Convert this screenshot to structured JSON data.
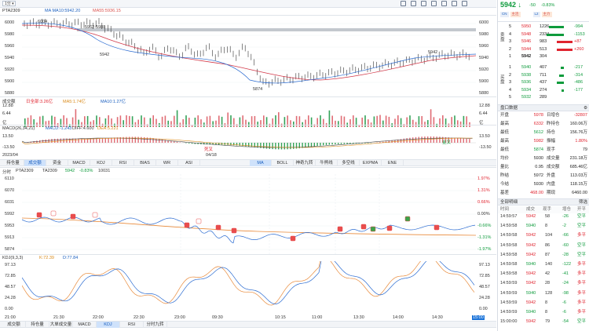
{
  "toolbar": {
    "period": "1分",
    "icons": [
      "grid-icon",
      "chart-icon",
      "gear-icon",
      "compare-icon",
      "tools-icon",
      "expand-icon",
      "settings-icon"
    ]
  },
  "kline": {
    "symbol": "PTA2309",
    "ma10": "MA MA10:5942.20",
    "ma55": "MA55:5936.15",
    "yticks": [
      "6000",
      "5980",
      "5960",
      "5940",
      "5920",
      "5900",
      "5880"
    ],
    "annotations": [
      "6004",
      "5962-5988",
      "5942",
      "5874",
      "5942"
    ],
    "date_left": "2023/04",
    "date_right": "04/18"
  },
  "volume": {
    "label": "成交额",
    "vol": "日全部:3.26亿",
    "ma5": "MA5:1.74亿",
    "ma10": "MA10:1.27亿",
    "yticks": [
      "12.88",
      "6.44",
      "亿"
    ]
  },
  "macd": {
    "label": "MACD(26,34,21)",
    "macd": "MACD:-1.243",
    "diff": "DIFF:4.600",
    "dea": "DEA:5.221",
    "yticks": [
      "13.50",
      "-13.50"
    ],
    "gold": "金叉",
    "dead": "死叉"
  },
  "tabs1": [
    "持仓量",
    "成交额",
    "资金",
    "MACD",
    "KDJ",
    "RSI",
    "BIAS",
    "WR",
    "ASI"
  ],
  "tabs1b": [
    "MA",
    "BOLL",
    "神奇九转",
    "牛熊线",
    "多空线",
    "EXPMA",
    "ENE"
  ],
  "intraday": {
    "label": "分时",
    "symbol": "PTA2309",
    "ta": "TA2309",
    "price": "5942",
    "change": "-0.83%",
    "vol": "10031",
    "yleft": [
      "6110",
      "6070",
      "6031",
      "5992",
      "5953",
      "5913",
      "5874"
    ],
    "yright": [
      "1.97%",
      "1.31%",
      "0.66%",
      "0.00%",
      "-0.66%",
      "-1.31%",
      "-1.97%"
    ]
  },
  "kdj": {
    "label": "KDJ(9,3,3)",
    "k": "K:72.39",
    "d": "D:77.84",
    "yticks": [
      "97.13",
      "72.85",
      "48.57",
      "24.28",
      "0.00"
    ]
  },
  "time_axis": [
    "21:00",
    "21:30",
    "22:00",
    "22:30",
    "23:00",
    "09:30",
    "10:15",
    "11:00",
    "13:30",
    "14:00",
    "14:30",
    "15:00"
  ],
  "tabs2": [
    "成交额",
    "持仓量",
    "大单成交量",
    "MACD",
    "KDJ",
    "RSI",
    "分时九转"
  ],
  "quote": {
    "price": "5942",
    "change": "-50",
    "pct": "-0.83%",
    "tags": [
      "CN",
      "主连",
      "L2",
      "主力"
    ],
    "asks": [
      {
        "n": "5",
        "p": "5950",
        "v": "1226",
        "d": "-994"
      },
      {
        "n": "4",
        "p": "5948",
        "v": "2334",
        "d": "-1153"
      },
      {
        "n": "3",
        "p": "5946",
        "v": "983",
        "d": "+87"
      },
      {
        "n": "2",
        "p": "5944",
        "v": "513",
        "d": "+260"
      },
      {
        "n": "1",
        "p": "5942",
        "v": "304",
        "d": ""
      }
    ],
    "bids": [
      {
        "n": "1",
        "p": "5940",
        "v": "407",
        "d": "-217"
      },
      {
        "n": "2",
        "p": "5938",
        "v": "711",
        "d": "-314"
      },
      {
        "n": "3",
        "p": "5936",
        "v": "437",
        "d": "-486"
      },
      {
        "n": "4",
        "p": "5934",
        "v": "274",
        "d": "-177"
      },
      {
        "n": "5",
        "p": "5932",
        "v": "289",
        "d": ""
      }
    ],
    "ask_label": "卖盘",
    "bid_label": "买盘"
  },
  "stats_title": "盘口数据",
  "stats": [
    [
      "开盘",
      "5978",
      "日增仓",
      "-32807"
    ],
    [
      "最高",
      "6332",
      "昨持仓",
      "160.06万"
    ],
    [
      "最低",
      "5612",
      "持仓",
      "156.76万"
    ],
    [
      "最高",
      "5982",
      "振幅",
      "1.80%"
    ],
    [
      "最低",
      "5874",
      "现手",
      "79"
    ],
    [
      "均价",
      "5930",
      "成交量",
      "231.18万"
    ],
    [
      "量比",
      "0.95",
      "成交额",
      "685.46亿"
    ],
    [
      "昨结",
      "5972",
      "外盘",
      "113.03万"
    ],
    [
      "今结",
      "5930",
      "内盘",
      "118.15万"
    ],
    [
      "基差",
      "468.00",
      "期现",
      "6460.00"
    ]
  ],
  "ticks_title": "全部明细",
  "ticks_filter": "筛选",
  "ticks_head": [
    "时间",
    "成交",
    "现手",
    "增仓",
    "开平"
  ],
  "ticks": [
    [
      "14:59:57",
      "5942",
      "58",
      "-26",
      "空平"
    ],
    [
      "14:59:58",
      "5940",
      "8",
      "-2",
      "空平"
    ],
    [
      "14:59:58",
      "5942",
      "104",
      "-66",
      "多平"
    ],
    [
      "14:59:58",
      "5942",
      "86",
      "-60",
      "空平"
    ],
    [
      "14:59:58",
      "5942",
      "87",
      "-28",
      "空平"
    ],
    [
      "14:59:58",
      "5940",
      "140",
      "-122",
      "多平"
    ],
    [
      "14:59:58",
      "5942",
      "42",
      "-41",
      "多平"
    ],
    [
      "14:59:59",
      "5942",
      "28",
      "-24",
      "多平"
    ],
    [
      "14:59:59",
      "5940",
      "128",
      "-98",
      "多平"
    ],
    [
      "14:59:59",
      "5942",
      "8",
      "-6",
      "多平"
    ],
    [
      "14:59:59",
      "5940",
      "8",
      "-6",
      "多平"
    ],
    [
      "15:00:00",
      "5942",
      "79",
      "-54",
      "空平"
    ]
  ]
}
